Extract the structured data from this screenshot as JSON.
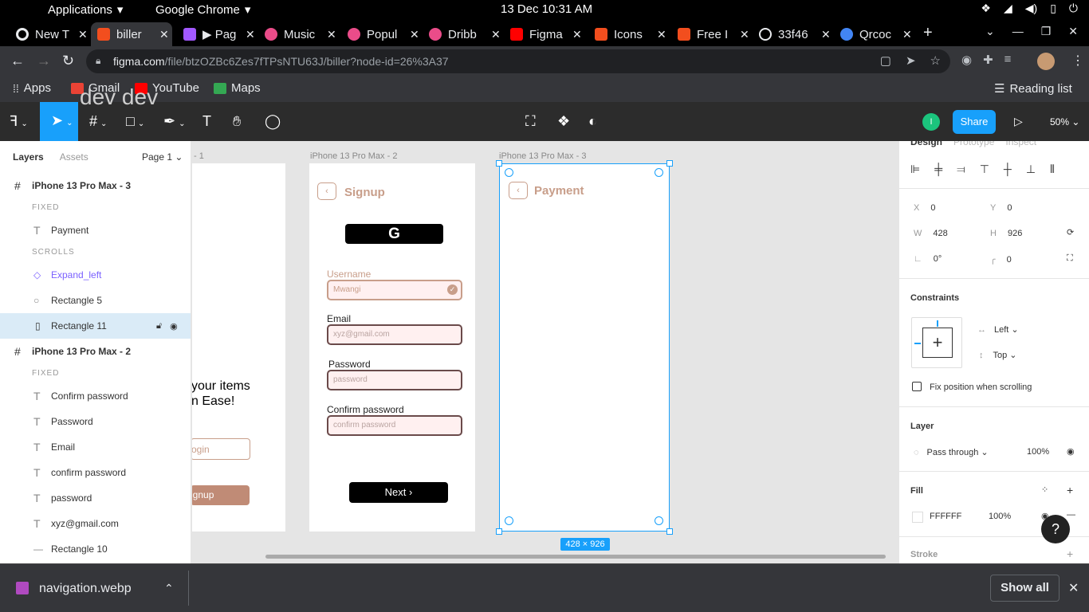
{
  "os": {
    "menu_apps": "Applications",
    "menu_chrome": "Google Chrome",
    "clock": "13 Dec  10:31 AM"
  },
  "tabs": [
    {
      "title": "New T",
      "color": "#e8eaed"
    },
    {
      "title": "biller",
      "color": "#f24e1e"
    },
    {
      "title": "▶ Pag",
      "color": "#a259ff"
    },
    {
      "title": "Music",
      "color": "#ea4c89"
    },
    {
      "title": "Popul",
      "color": "#ea4c89"
    },
    {
      "title": "Dribb",
      "color": "#ea4c89"
    },
    {
      "title": "Figma",
      "color": "#ff0000"
    },
    {
      "title": "Icons",
      "color": "#f24e1e"
    },
    {
      "title": "Free I",
      "color": "#f24e1e"
    },
    {
      "title": "33f46",
      "color": "#e8eaed"
    },
    {
      "title": "Qrcoc",
      "color": "#4285f4"
    }
  ],
  "address": {
    "host": "figma.com",
    "path": "/file/btzOZBc6Zes7fTPsNTU63J/biller?node-id=26%3A37"
  },
  "bookmarks": {
    "apps": "Apps",
    "gmail": "Gmail",
    "youtube": "YouTube",
    "maps": "Maps",
    "reading_list": "Reading list"
  },
  "overlay_text": "dev dev",
  "figma_toolbar": {
    "user_initial": "I",
    "share": "Share",
    "zoom": "50%"
  },
  "layers_panel": {
    "tab_layers": "Layers",
    "tab_assets": "Assets",
    "page": "Page 1",
    "rows": [
      {
        "label": "iPhone 13 Pro Max - 3",
        "kind": "frame"
      },
      {
        "label": "FIXED",
        "kind": "section"
      },
      {
        "label": "Payment",
        "kind": "text"
      },
      {
        "label": "SCROLLS",
        "kind": "section"
      },
      {
        "label": "Expand_left",
        "kind": "component"
      },
      {
        "label": "Rectangle 5",
        "kind": "ellipse"
      },
      {
        "label": "Rectangle 11",
        "kind": "rect-selected"
      },
      {
        "label": "iPhone 13 Pro Max - 2",
        "kind": "frame"
      },
      {
        "label": "FIXED",
        "kind": "section"
      },
      {
        "label": "Confirm password",
        "kind": "text"
      },
      {
        "label": "Password",
        "kind": "text"
      },
      {
        "label": "Email",
        "kind": "text"
      },
      {
        "label": "confirm password",
        "kind": "text"
      },
      {
        "label": "password",
        "kind": "text"
      },
      {
        "label": "xyz@gmail.com",
        "kind": "text"
      },
      {
        "label": "Rectangle 10",
        "kind": "line"
      }
    ]
  },
  "canvas": {
    "frame1_label": "- 1",
    "frame1_text1": "your items",
    "frame1_text2": "n Ease!",
    "frame1_login": "ogin",
    "frame1_signup": "ignup",
    "frame2_label": "iPhone 13 Pro Max - 2",
    "frame2_title": "Signup",
    "username_label": "Username",
    "username_value": "Mwangi",
    "email_label": "Email",
    "email_placeholder": "xyz@gmail.com",
    "password_label": "Password",
    "password_placeholder": "password",
    "confirm_label": "Confirm password",
    "confirm_placeholder": "confirm password",
    "next": "Next",
    "frame3_label": "iPhone 13 Pro Max - 3",
    "frame3_title": "Payment",
    "dimension": "428 × 926"
  },
  "design_panel": {
    "tab_design": "Design",
    "tab_prototype": "Prototype",
    "tab_inspect": "Inspect",
    "x": "0",
    "y": "0",
    "w": "428",
    "h": "926",
    "rotation": "0°",
    "radius": "0",
    "constraints_title": "Constraints",
    "constraint_h": "Left",
    "constraint_v": "Top",
    "fix_position": "Fix position when scrolling",
    "layer_title": "Layer",
    "blend": "Pass through",
    "opacity": "100%",
    "fill_title": "Fill",
    "fill_hex": "FFFFFF",
    "fill_opacity": "100%",
    "stroke_title": "Stroke"
  },
  "download_bar": {
    "filename": "navigation.webp",
    "show_all": "Show all"
  }
}
